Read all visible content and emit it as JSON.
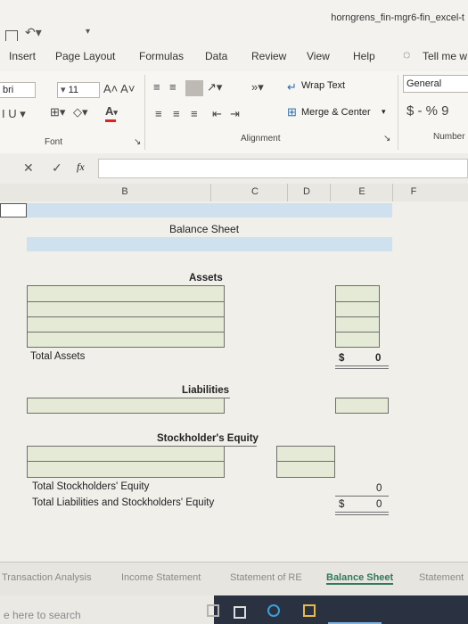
{
  "window": {
    "title": "horngrens_fin-mgr6-fin_excel-t"
  },
  "tabs": [
    "Insert",
    "Page Layout",
    "Formulas",
    "Data",
    "Review",
    "View",
    "Help"
  ],
  "tell_me": "Tell me w",
  "ribbon": {
    "font_name": "bri",
    "font_size": "11",
    "font_grow": "A˄ A˅",
    "underline_controls": "I  U  ▾",
    "wrap_text": "Wrap Text",
    "merge_center": "Merge & Center",
    "number_format": "General",
    "currency": "$ - % 9",
    "group_font": "Font",
    "group_alignment": "Alignment",
    "group_number": "Number"
  },
  "formula_bar": {
    "cancel": "✕",
    "enter": "✓",
    "fx": "fx",
    "value": ""
  },
  "columns": [
    "B",
    "C",
    "D",
    "E",
    "F"
  ],
  "sheet": {
    "title": "Balance Sheet",
    "assets_header": "Assets",
    "total_assets_label": "Total Assets",
    "total_assets_currency": "$",
    "total_assets_value": "0",
    "liabilities_header": "Liabilities",
    "equity_header": "Stockholder's Equity",
    "total_equity_label": "Total Stockholders' Equity",
    "total_equity_value": "0",
    "total_liab_equity_label": "Total Liabilities and Stockholders' Equity",
    "total_liab_equity_currency": "$",
    "total_liab_equity_value": "0"
  },
  "sheet_tabs": [
    "Transaction Analysis",
    "Income Statement",
    "Statement of RE",
    "Balance Sheet",
    "Statement"
  ],
  "active_sheet": "Balance Sheet",
  "taskbar": {
    "search_placeholder": "e here to search"
  }
}
